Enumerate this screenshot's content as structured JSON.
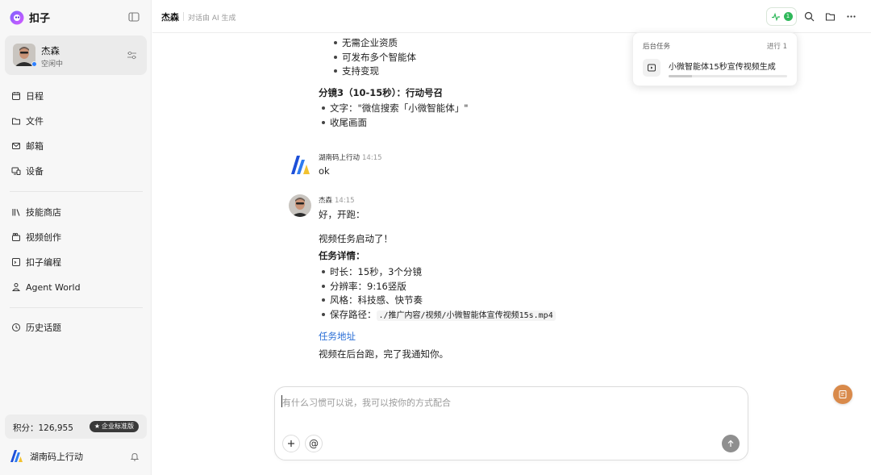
{
  "app": {
    "name": "扣子"
  },
  "user": {
    "name": "杰森",
    "status": "空闲中"
  },
  "nav": {
    "schedule": "日程",
    "files": "文件",
    "mail": "邮箱",
    "devices": "设备",
    "skills_store": "技能商店",
    "video_creation": "视频创作",
    "coze_coding": "扣子编程",
    "agent_world": "Agent World",
    "history": "历史话题"
  },
  "points": {
    "label": "积分：126,955",
    "plan": "企业标准版"
  },
  "account": {
    "name": "湖南码上行动"
  },
  "header": {
    "title": "杰森",
    "subtitle": "对话由 AI 生成",
    "activity_count": "1"
  },
  "task_popover": {
    "title": "后台任务",
    "status": "进行 1",
    "task_name": "小微智能体15秒宣传视频生成",
    "progress": 0.2
  },
  "chat": {
    "earlier": {
      "b1": "无需企业资质",
      "b2": "可发布多个智能体",
      "b3": "支持变现",
      "shot3_title": "分镜3（10-15秒）：行动号召",
      "shot3_b1": "文字：\"微信搜索「小微智能体」\"",
      "shot3_b2": "收尾画面"
    },
    "msg_ok": {
      "author": "湖南码上行动",
      "time": "14:15",
      "text": "ok"
    },
    "msg_reply": {
      "author": "杰森",
      "time": "14:15",
      "line1": "好，开跑：",
      "line2": "视频任务启动了！",
      "details_title": "任务详情：",
      "d1": "时长：15秒，3个分镜",
      "d2": "分辨率：9:16竖版",
      "d3": "风格：科技感、快节奏",
      "d4_label": "保存路径：",
      "d4_path": "./推广内容/视频/小微智能体宣传视频15s.mp4",
      "link": "任务地址",
      "closing": "视频在后台跑，完了我通知你。"
    }
  },
  "composer": {
    "placeholder": "有什么习惯可以说，我可以按你的方式配合"
  }
}
